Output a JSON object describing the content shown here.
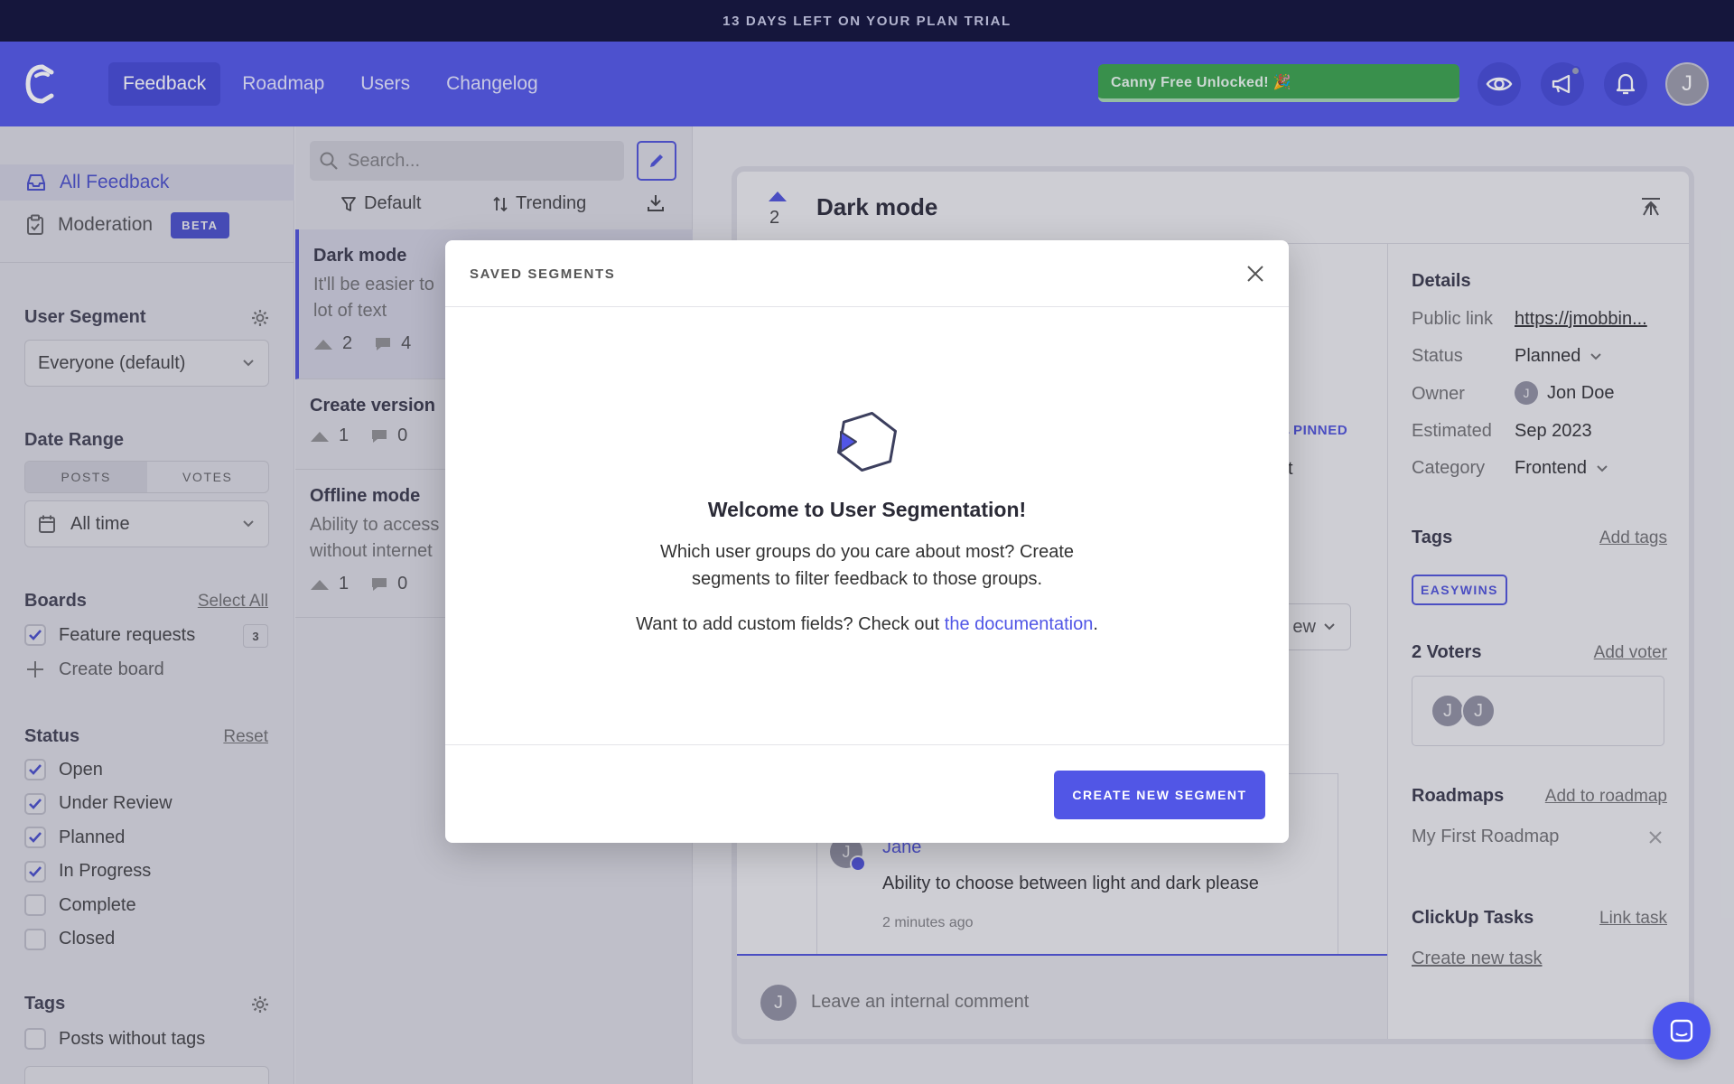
{
  "trial_banner": "13 DAYS LEFT ON YOUR PLAN TRIAL",
  "nav": {
    "tabs": [
      "Feedback",
      "Roadmap",
      "Users",
      "Changelog"
    ],
    "unlock_text": "Canny Free Unlocked! 🎉",
    "avatar_initial": "J",
    "brand_color": "#5156e6"
  },
  "sidebar": {
    "all_feedback": "All Feedback",
    "moderation": "Moderation",
    "beta": "BETA",
    "user_segment": {
      "title": "User Segment",
      "value": "Everyone (default)"
    },
    "date_range": {
      "title": "Date Range",
      "toggle": [
        "POSTS",
        "VOTES"
      ],
      "value": "All time"
    },
    "boards": {
      "title": "Boards",
      "select_all": "Select All",
      "items": [
        {
          "label": "Feature requests",
          "count": "3",
          "checked": true
        }
      ],
      "create": "Create board"
    },
    "status": {
      "title": "Status",
      "reset": "Reset",
      "items": [
        {
          "label": "Open",
          "checked": true
        },
        {
          "label": "Under Review",
          "checked": true
        },
        {
          "label": "Planned",
          "checked": true
        },
        {
          "label": "In Progress",
          "checked": true
        },
        {
          "label": "Complete",
          "checked": false
        },
        {
          "label": "Closed",
          "checked": false
        }
      ]
    },
    "tags": {
      "title": "Tags",
      "items": [
        {
          "label": "Posts without tags",
          "checked": false
        }
      ]
    }
  },
  "list": {
    "search_placeholder": "Search...",
    "filter_default": "Default",
    "filter_trending": "Trending",
    "posts": [
      {
        "title": "Dark mode",
        "desc1": "It'll be easier to",
        "desc2": "lot of text",
        "votes": "2",
        "comments": "4"
      },
      {
        "title": "Create version",
        "votes": "1",
        "comments": "0"
      },
      {
        "title": "Offline mode",
        "desc1": "Ability to access",
        "desc2": "without internet",
        "votes": "1",
        "comments": "0"
      }
    ]
  },
  "detail": {
    "title": "Dark mode",
    "votes": "2",
    "pinned": "PINNED",
    "text_fragment": "xt",
    "view_fragment": "ew",
    "comment": {
      "author": "Jane",
      "text": "Ability to choose between light and dark please",
      "time": "2 minutes ago"
    },
    "internal_comment_placeholder": "Leave an internal comment",
    "details": {
      "title": "Details",
      "public_link_label": "Public link",
      "public_link": "https://jmobbin...",
      "status_label": "Status",
      "status": "Planned",
      "owner_label": "Owner",
      "owner": "Jon Doe",
      "estimated_label": "Estimated",
      "estimated": "Sep 2023",
      "category_label": "Category",
      "category": "Frontend"
    },
    "tags": {
      "title": "Tags",
      "add": "Add tags",
      "items": [
        "EASYWINS"
      ]
    },
    "voters": {
      "title": "2 Voters",
      "add": "Add voter"
    },
    "roadmaps": {
      "title": "Roadmaps",
      "add": "Add to roadmap",
      "item": "My First Roadmap"
    },
    "clickup": {
      "title": "ClickUp Tasks",
      "link": "Link task",
      "create": "Create new task"
    }
  },
  "modal": {
    "title": "SAVED SEGMENTS",
    "heading": "Welcome to User Segmentation!",
    "body_line1": "Which user groups do you care about most? Create",
    "body_line2": "segments to filter feedback to those groups.",
    "custom_prefix": "Want to add custom fields? Check out ",
    "custom_link": "the documentation",
    "custom_suffix": ".",
    "button": "CREATE NEW SEGMENT"
  }
}
